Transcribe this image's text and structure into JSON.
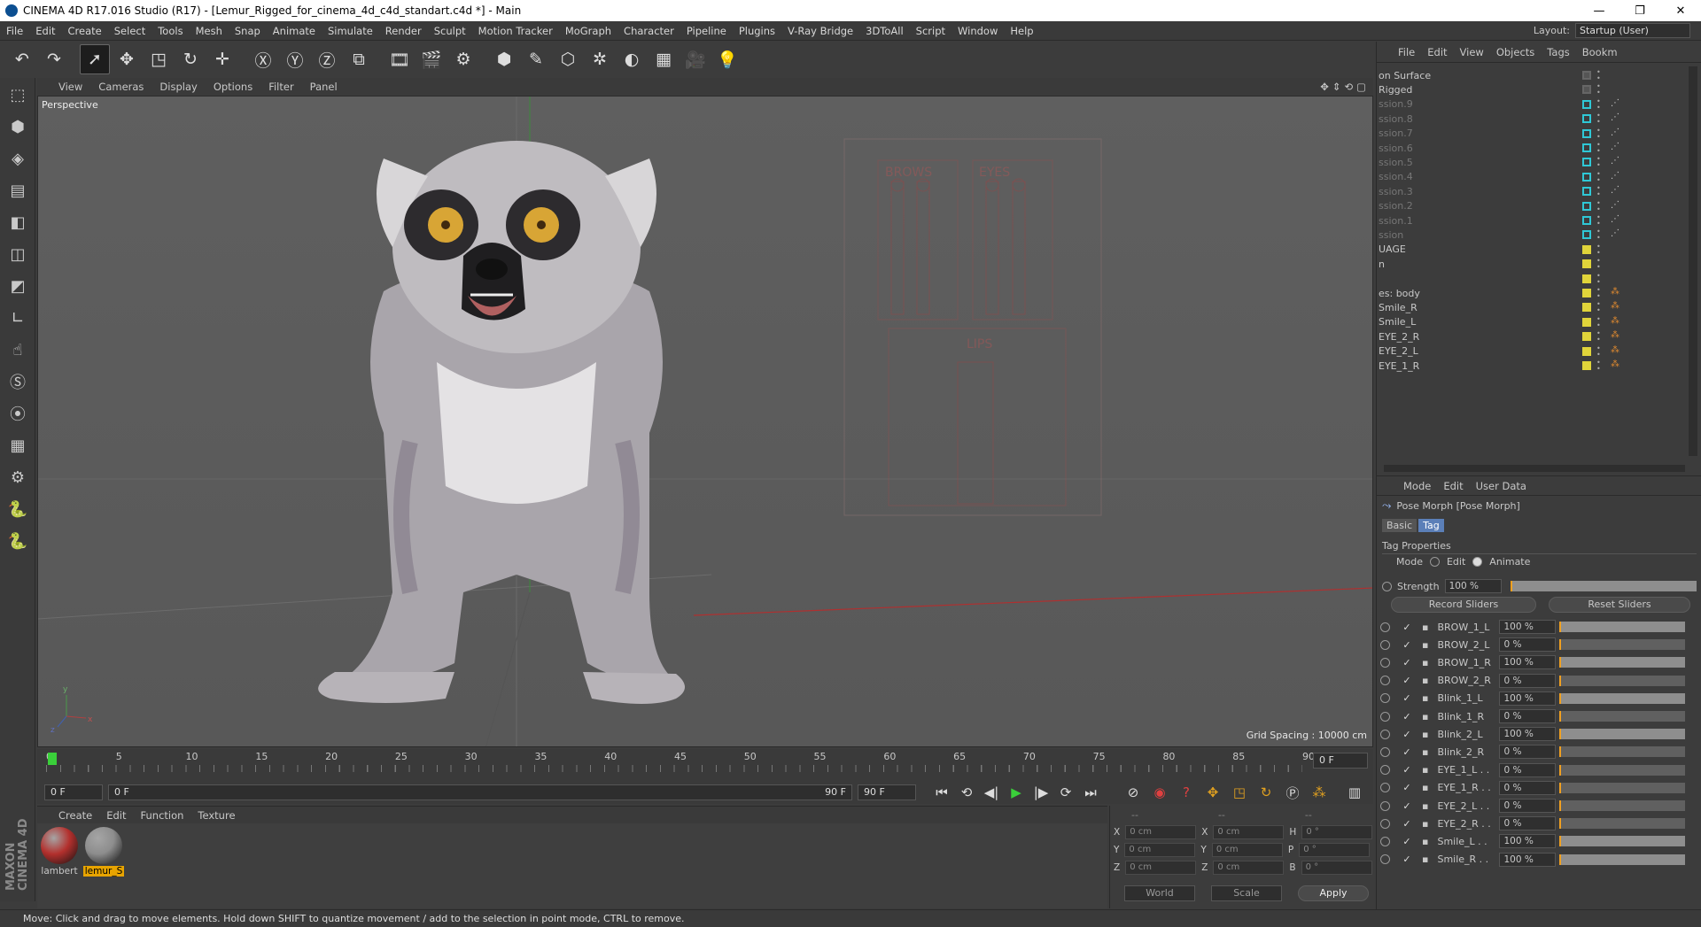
{
  "window": {
    "title": "CINEMA 4D R17.016 Studio (R17) - [Lemur_Rigged_for_cinema_4d_c4d_standart.c4d *] - Main",
    "minimize": "—",
    "maximize": "❐",
    "close": "✕"
  },
  "menu": [
    "File",
    "Edit",
    "Create",
    "Select",
    "Tools",
    "Mesh",
    "Snap",
    "Animate",
    "Simulate",
    "Render",
    "Sculpt",
    "Motion Tracker",
    "MoGraph",
    "Character",
    "Pipeline",
    "Plugins",
    "V-Ray Bridge",
    "3DToAll",
    "Script",
    "Window",
    "Help"
  ],
  "layout": {
    "label": "Layout:",
    "value": "Startup (User)"
  },
  "toolbar": [
    "undo-icon",
    "redo-icon",
    "select-icon",
    "move-icon",
    "scale-icon",
    "rotate-icon",
    "transform-icon",
    "x-axis-icon",
    "y-axis-icon",
    "z-axis-icon",
    "coord-system-icon",
    "render-view-icon",
    "render-picture-queue-icon",
    "render-settings-icon",
    "cube-icon",
    "pen-icon",
    "subdivision-icon",
    "array-icon",
    "deformer-icon",
    "floor-icon",
    "camera-icon",
    "light-icon"
  ],
  "toolbar_glyphs": {
    "undo-icon": "↶",
    "redo-icon": "↷",
    "select-icon": "➚",
    "move-icon": "✥",
    "scale-icon": "◳",
    "rotate-icon": "↻",
    "transform-icon": "✛",
    "x-axis-icon": "Ⓧ",
    "y-axis-icon": "Ⓨ",
    "z-axis-icon": "Ⓩ",
    "coord-system-icon": "⧉",
    "render-view-icon": "🎞",
    "render-picture-queue-icon": "🎬",
    "render-settings-icon": "⚙",
    "cube-icon": "⬢",
    "pen-icon": "✎",
    "subdivision-icon": "⬡",
    "array-icon": "✲",
    "deformer-icon": "◐",
    "floor-icon": "▦",
    "camera-icon": "🎥",
    "light-icon": "💡"
  },
  "left_tools": [
    "⬚",
    "⬢",
    "◈",
    "▤",
    "◧",
    "◫",
    "◩",
    "∟",
    "☝",
    "Ⓢ",
    "⦿",
    "▦",
    "⚙",
    "🐍",
    "🐍"
  ],
  "viewport": {
    "menu": [
      "View",
      "Cameras",
      "Display",
      "Options",
      "Filter",
      "Panel"
    ],
    "label": "Perspective",
    "grid_spacing": "Grid Spacing : 10000 cm",
    "panel_labels": [
      "BROWS",
      "EYES",
      "LIPS"
    ]
  },
  "timeline": {
    "ticks": [
      "0",
      "5",
      "10",
      "15",
      "20",
      "25",
      "30",
      "35",
      "40",
      "45",
      "50",
      "55",
      "60",
      "65",
      "70",
      "75",
      "80",
      "85",
      "90"
    ],
    "current_frame": "0 F",
    "start": "0 F",
    "range_start": "0 F",
    "range_end": "90 F",
    "end": "90 F"
  },
  "playback": [
    "⏮",
    "⟲",
    "◀|",
    "▶",
    "|▶",
    "⟳",
    "⏭"
  ],
  "material_menu": [
    "Create",
    "Edit",
    "Function",
    "Texture"
  ],
  "materials": [
    {
      "name": "lambert",
      "color": "#b3302d"
    },
    {
      "name": "lemur_S",
      "color": "#8d8d8d"
    }
  ],
  "coords": {
    "header": [
      "--",
      "--",
      "--"
    ],
    "rows": [
      {
        "a": "X",
        "av": "0 cm",
        "b": "X",
        "bv": "0 cm",
        "c": "H",
        "cv": "0 °"
      },
      {
        "a": "Y",
        "av": "0 cm",
        "b": "Y",
        "bv": "0 cm",
        "c": "P",
        "cv": "0 °"
      },
      {
        "a": "Z",
        "av": "0 cm",
        "b": "Z",
        "bv": "0 cm",
        "c": "B",
        "cv": "0 °"
      }
    ],
    "world": "World",
    "scale": "Scale",
    "apply": "Apply"
  },
  "status": "Move: Click and drag to move elements. Hold down SHIFT to quantize movement / add to the selection in point mode, CTRL to remove.",
  "object_manager": {
    "menu": [
      "File",
      "Edit",
      "View",
      "Objects",
      "Tags",
      "Bookm"
    ],
    "rows": [
      {
        "name": "on Surface",
        "color": "gray",
        "dim": false
      },
      {
        "name": "Rigged",
        "color": "gray",
        "dim": false
      },
      {
        "name": "ssion.9",
        "color": "cyan",
        "dim": true
      },
      {
        "name": "ssion.8",
        "color": "cyan",
        "dim": true
      },
      {
        "name": "ssion.7",
        "color": "cyan",
        "dim": true
      },
      {
        "name": "ssion.6",
        "color": "cyan",
        "dim": true
      },
      {
        "name": "ssion.5",
        "color": "cyan",
        "dim": true
      },
      {
        "name": "ssion.4",
        "color": "cyan",
        "dim": true
      },
      {
        "name": "ssion.3",
        "color": "cyan",
        "dim": true
      },
      {
        "name": "ssion.2",
        "color": "cyan",
        "dim": true
      },
      {
        "name": "ssion.1",
        "color": "cyan",
        "dim": true
      },
      {
        "name": "ssion",
        "color": "cyan",
        "dim": true
      },
      {
        "name": "UAGE",
        "color": "yellow",
        "dim": false
      },
      {
        "name": "n",
        "color": "yellow",
        "dim": false
      },
      {
        "name": "",
        "color": "yellow",
        "dim": false
      },
      {
        "name": "es: body",
        "color": "yellow",
        "dim": false
      },
      {
        "name": "Smile_R",
        "color": "yellow",
        "dim": false
      },
      {
        "name": "Smile_L",
        "color": "yellow",
        "dim": false
      },
      {
        "name": "EYE_2_R",
        "color": "yellow",
        "dim": false
      },
      {
        "name": "EYE_2_L",
        "color": "yellow",
        "dim": false
      },
      {
        "name": "EYE_1_R",
        "color": "yellow",
        "dim": false
      }
    ]
  },
  "attributes": {
    "menu": [
      "Mode",
      "Edit",
      "User Data"
    ],
    "object_title": "Pose Morph [Pose Morph]",
    "tabs": [
      "Basic",
      "Tag"
    ],
    "section": "Tag Properties",
    "mode_label": "Mode",
    "mode_edit": "Edit",
    "mode_animate": "Animate",
    "strength_label": "Strength",
    "strength_value": "100 %",
    "record_button": "Record Sliders",
    "reset_button": "Reset Sliders",
    "sliders": [
      {
        "name": "BROW_1_L",
        "value": "100 %",
        "level": 1.0
      },
      {
        "name": "BROW_2_L",
        "value": "0 %",
        "level": 0
      },
      {
        "name": "BROW_1_R",
        "value": "100 %",
        "level": 1.0
      },
      {
        "name": "BROW_2_R",
        "value": "0 %",
        "level": 0
      },
      {
        "name": "Blink_1_L",
        "value": "100 %",
        "level": 1.0
      },
      {
        "name": "Blink_1_R",
        "value": "0 %",
        "level": 0
      },
      {
        "name": "Blink_2_L",
        "value": "100 %",
        "level": 1.0
      },
      {
        "name": "Blink_2_R",
        "value": "0 %",
        "level": 0
      },
      {
        "name": "EYE_1_L . .",
        "value": "0 %",
        "level": 0
      },
      {
        "name": "EYE_1_R . .",
        "value": "0 %",
        "level": 0
      },
      {
        "name": "EYE_2_L . .",
        "value": "0 %",
        "level": 0
      },
      {
        "name": "EYE_2_R . .",
        "value": "0 %",
        "level": 0
      },
      {
        "name": "Smile_L . .",
        "value": "100 %",
        "level": 1.0
      },
      {
        "name": "Smile_R . .",
        "value": "100 %",
        "level": 1.0
      }
    ]
  }
}
